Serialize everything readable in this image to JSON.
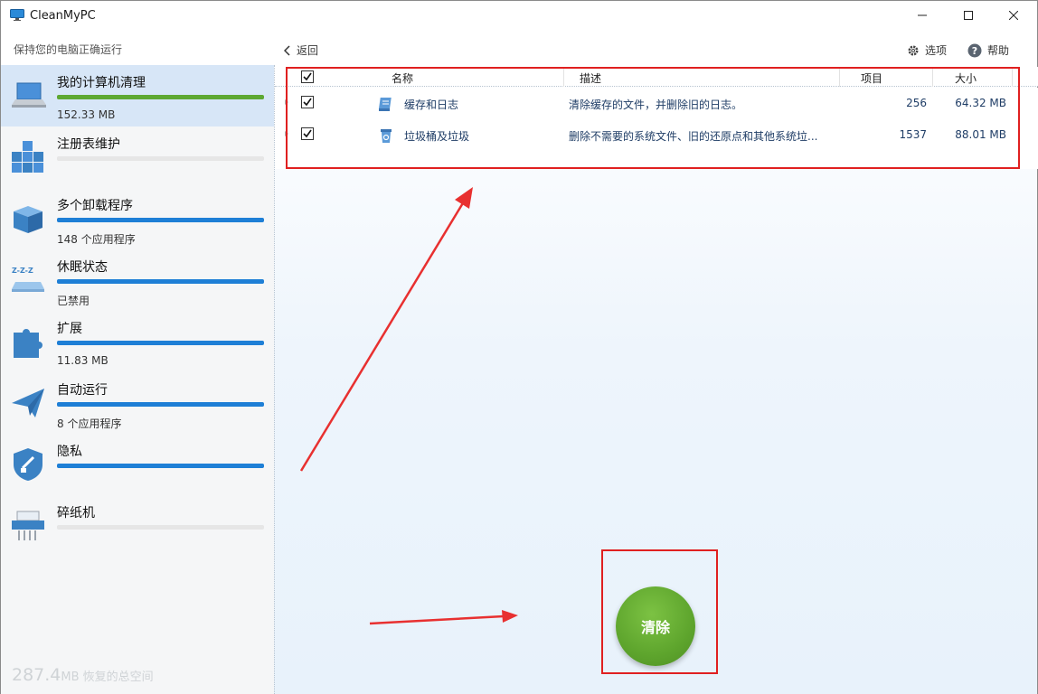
{
  "window": {
    "title": "CleanMyPC",
    "minimize_icon": "minimize-icon",
    "maximize_icon": "maximize-icon",
    "close_icon": "close-icon"
  },
  "header": {
    "subtitle": "保持您的电脑正确运行",
    "back_label": "返回",
    "options_label": "选项",
    "help_label": "帮助"
  },
  "sidebar": {
    "items": [
      {
        "label": "我的计算机清理",
        "sub": "152.33 MB",
        "progress": 1.0,
        "color": "#5da832",
        "icon": "laptop-icon",
        "active": true
      },
      {
        "label": "注册表维护",
        "sub": "",
        "progress": 0.0,
        "color": "#1e7fd6",
        "icon": "registry-cubes-icon",
        "active": false
      },
      {
        "label": "多个卸载程序",
        "sub": "148 个应用程序",
        "progress": 1.0,
        "color": "#1e7fd6",
        "icon": "box-icon",
        "active": false
      },
      {
        "label": "休眠状态",
        "sub": "已禁用",
        "progress": 1.0,
        "color": "#1e7fd6",
        "icon": "sleep-laptop-icon",
        "active": false
      },
      {
        "label": "扩展",
        "sub": "11.83 MB",
        "progress": 1.0,
        "color": "#1e7fd6",
        "icon": "puzzle-icon",
        "active": false
      },
      {
        "label": "自动运行",
        "sub": "8 个应用程序",
        "progress": 1.0,
        "color": "#1e7fd6",
        "icon": "paper-plane-icon",
        "active": false
      },
      {
        "label": "隐私",
        "sub": "",
        "progress": 1.0,
        "color": "#1e7fd6",
        "icon": "shield-icon",
        "active": false
      },
      {
        "label": "碎纸机",
        "sub": "",
        "progress": 0.0,
        "color": "#1e7fd6",
        "icon": "shredder-icon",
        "active": false
      }
    ],
    "total_value": "287.4",
    "total_unit": "MB 恢复的总空间"
  },
  "table": {
    "columns": [
      "名称",
      "描述",
      "项目",
      "大小"
    ],
    "rows": [
      {
        "name": "缓存和日志",
        "desc": "清除缓存的文件，并删除旧的日志。",
        "count": "256",
        "size": "64.32 MB",
        "checked": true
      },
      {
        "name": "垃圾桶及垃圾",
        "desc": "删除不需要的系统文件、旧的还原点和其他系统垃...",
        "count": "1537",
        "size": "88.01 MB",
        "checked": true
      }
    ]
  },
  "actions": {
    "clean_label": "清除"
  },
  "colors": {
    "accent_green": "#5da832",
    "accent_blue": "#1e7fd6",
    "annotation_red": "#e02020"
  }
}
